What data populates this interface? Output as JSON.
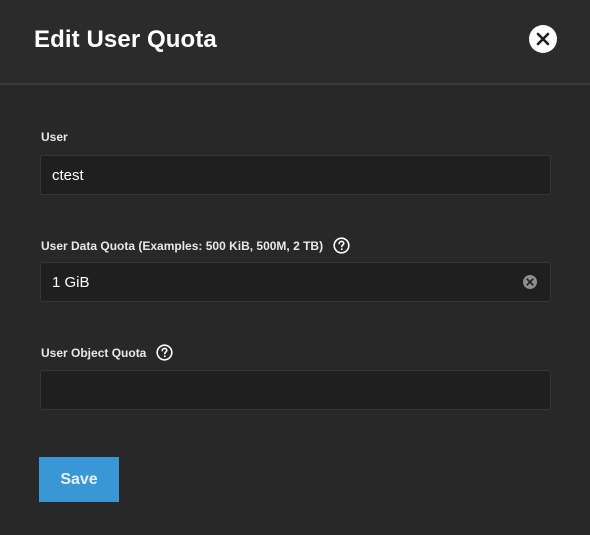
{
  "dialog": {
    "title": "Edit User Quota",
    "close_icon": "close-icon"
  },
  "fields": {
    "user": {
      "label": "User",
      "value": "ctest"
    },
    "data_quota": {
      "label": "User Data Quota (Examples: 500 KiB, 500M, 2 TB)",
      "value": "1 GiB",
      "help_icon": "help-icon",
      "clear_icon": "clear-icon"
    },
    "object_quota": {
      "label": "User Object Quota",
      "value": "",
      "help_icon": "help-icon"
    }
  },
  "actions": {
    "save_label": "Save"
  },
  "colors": {
    "background": "#282828",
    "field_background": "#1f1f1f",
    "primary": "#3a97d6"
  }
}
